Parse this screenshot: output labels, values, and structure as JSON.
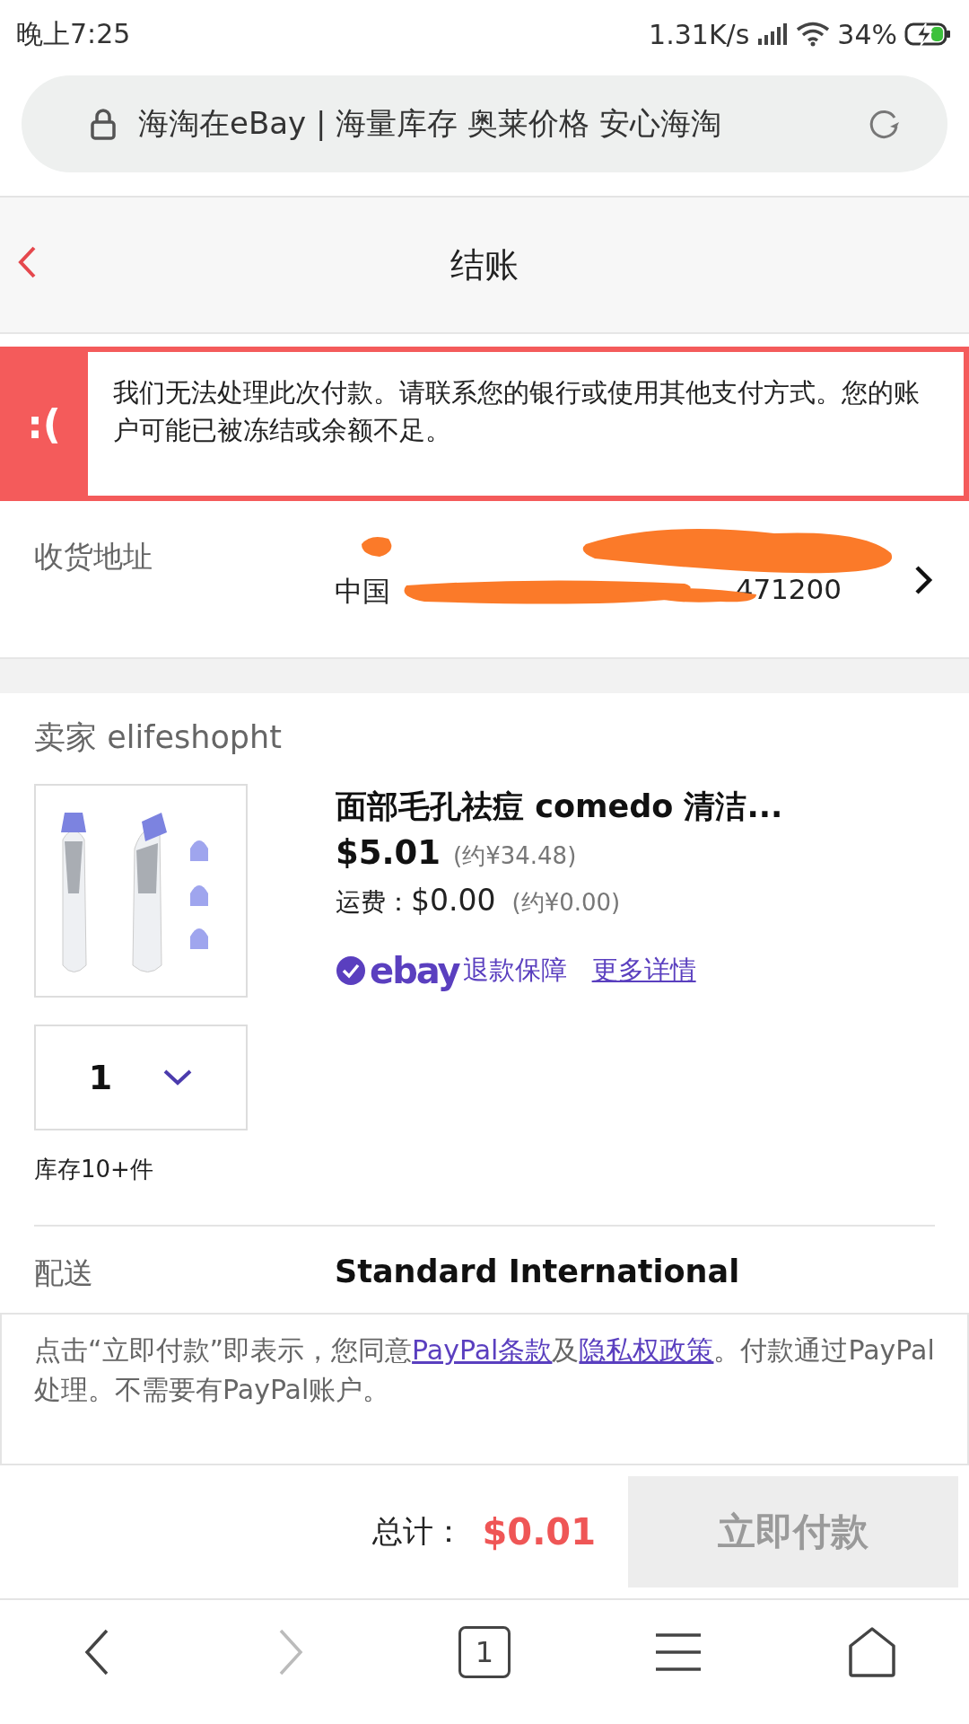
{
  "status_bar": {
    "time": "晚上7:25",
    "speed": "1.31K/s",
    "battery": "34%"
  },
  "url_bar": {
    "title": "海淘在eBay | 海量库存 奥莱价格 安心海淘"
  },
  "header": {
    "title": "结账"
  },
  "error": {
    "face": ":(",
    "message": "我们无法处理此次付款。请联系您的银行或使用其他支付方式。您的账户可能已被冻结或余额不足。"
  },
  "address": {
    "label": "收货地址",
    "visible_start": "中国",
    "visible_end": "471200"
  },
  "seller": {
    "label": "卖家 elifeshopht"
  },
  "item": {
    "title": "面部毛孔祛痘 comedo 清洁...",
    "price": "$5.01",
    "price_cny": "(约¥34.48)",
    "shipping_label": "运费：",
    "shipping": "$0.00",
    "shipping_cny": "(约¥0.00)",
    "guarantee_logo": "ebay",
    "guarantee": "退款保障",
    "more": "更多详情",
    "quantity": "1",
    "stock": "库存10+件"
  },
  "delivery": {
    "label": "配送",
    "method": "Standard International"
  },
  "legal": [
    {
      "kind": "text",
      "text": "点击“立即付款”即表示，您同意"
    },
    {
      "kind": "link",
      "text": "PayPal条款"
    },
    {
      "kind": "text",
      "text": "及"
    },
    {
      "kind": "link",
      "text": "隐私权政策"
    },
    {
      "kind": "text",
      "text": "。付款通过PayPal处理。不需要有PayPal账户。"
    }
  ],
  "total": {
    "label": "总计：",
    "amount": "$0.01"
  },
  "pay_button": {
    "label": "立即付款",
    "disabled": true
  },
  "nav": [
    {
      "kind": "back",
      "disabled": false
    },
    {
      "kind": "forward",
      "disabled": true
    },
    {
      "kind": "tabs",
      "count": "1",
      "disabled": false
    },
    {
      "kind": "menu",
      "disabled": false
    },
    {
      "kind": "home",
      "disabled": false
    }
  ]
}
